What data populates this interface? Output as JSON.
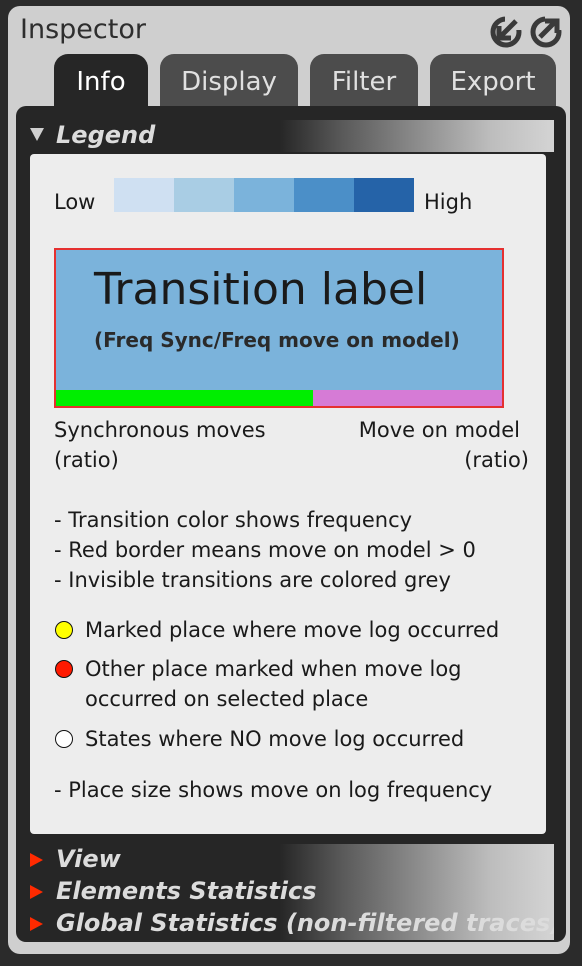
{
  "window": {
    "title": "Inspector",
    "header_icons": [
      "collapse-icon",
      "expand-icon"
    ]
  },
  "tabs": [
    {
      "label": "Info",
      "active": true
    },
    {
      "label": "Display",
      "active": false
    },
    {
      "label": "Filter",
      "active": false
    },
    {
      "label": "Export",
      "active": false
    }
  ],
  "sections": {
    "legend": {
      "label": "Legend",
      "expanded": true
    },
    "view": {
      "label": "View",
      "expanded": false
    },
    "elements_statistics": {
      "label": "Elements Statistics",
      "expanded": false
    },
    "global_statistics": {
      "label": "Global Statistics (non-filtered traces)",
      "expanded": false
    }
  },
  "legend": {
    "scale": {
      "low_label": "Low",
      "high_label": "High",
      "colors": [
        "#cfe0f2",
        "#a9cde4",
        "#7bb3db",
        "#4b8fc8",
        "#2563a8"
      ]
    },
    "transition": {
      "label": "Transition label",
      "sublabel": "(Freq Sync/Freq move on model)",
      "fill_color": "#7bb3db",
      "border_color": "#e53030",
      "sync_color": "#00ee00",
      "model_color": "#d67bd6",
      "sync_ratio": 0.577
    },
    "moves": {
      "sync_line1": "Synchronous moves",
      "sync_line2": "(ratio)",
      "model_line1": "Move on model",
      "model_line2": "(ratio)"
    },
    "notes": [
      "- Transition color shows frequency",
      "- Red border means move on model > 0",
      "- Invisible transitions are colored grey"
    ],
    "places": [
      {
        "color": "#ffff00",
        "line1": "Marked place where move log occurred",
        "line2": ""
      },
      {
        "color": "#ff1a00",
        "line1": "Other place marked when move log",
        "line2": "occurred on selected place"
      },
      {
        "color": "#ffffff",
        "line1": "States where NO move log occurred",
        "line2": ""
      }
    ],
    "place_size_note": "- Place size shows move on log frequency"
  }
}
